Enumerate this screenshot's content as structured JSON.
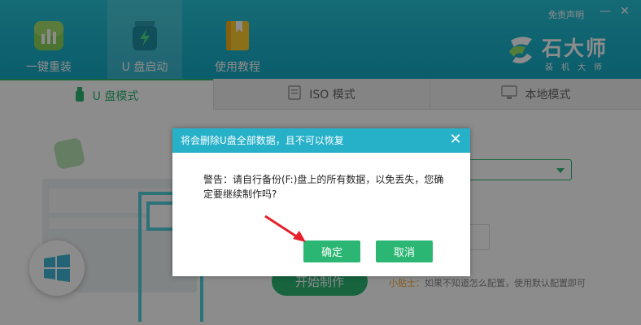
{
  "header": {
    "nav": [
      {
        "label": "一键重装",
        "icon": "chart-icon"
      },
      {
        "label": "U 盘启动",
        "icon": "usb-icon"
      },
      {
        "label": "使用教程",
        "icon": "book-icon"
      }
    ],
    "disclaimer": "免责声明",
    "minimize_symbol": "—",
    "close_symbol": "✕",
    "brand": {
      "name": "石大师",
      "subtitle": "装机大师"
    }
  },
  "tabs": [
    {
      "label": "U 盘模式"
    },
    {
      "label": "ISO 模式"
    },
    {
      "label": "本地模式"
    }
  ],
  "main": {
    "start_button": "开始制作",
    "tip_key": "小贴士：",
    "tip_text": "如果不知道怎么配置，使用默认配置即可"
  },
  "dialog": {
    "title": "将会删除U盘全部数据，且不可以恢复",
    "close_symbol": "✕",
    "message": "警告：请自行备份(F:)盘上的所有数据，以免丢失，您确定要继续制作吗?",
    "confirm": "确定",
    "cancel": "取消"
  },
  "colors": {
    "header": "#1fb6cd",
    "accent_green": "#2bb673",
    "dialog_title": "#27b1c9",
    "annotation_arrow": "#e5202a"
  }
}
